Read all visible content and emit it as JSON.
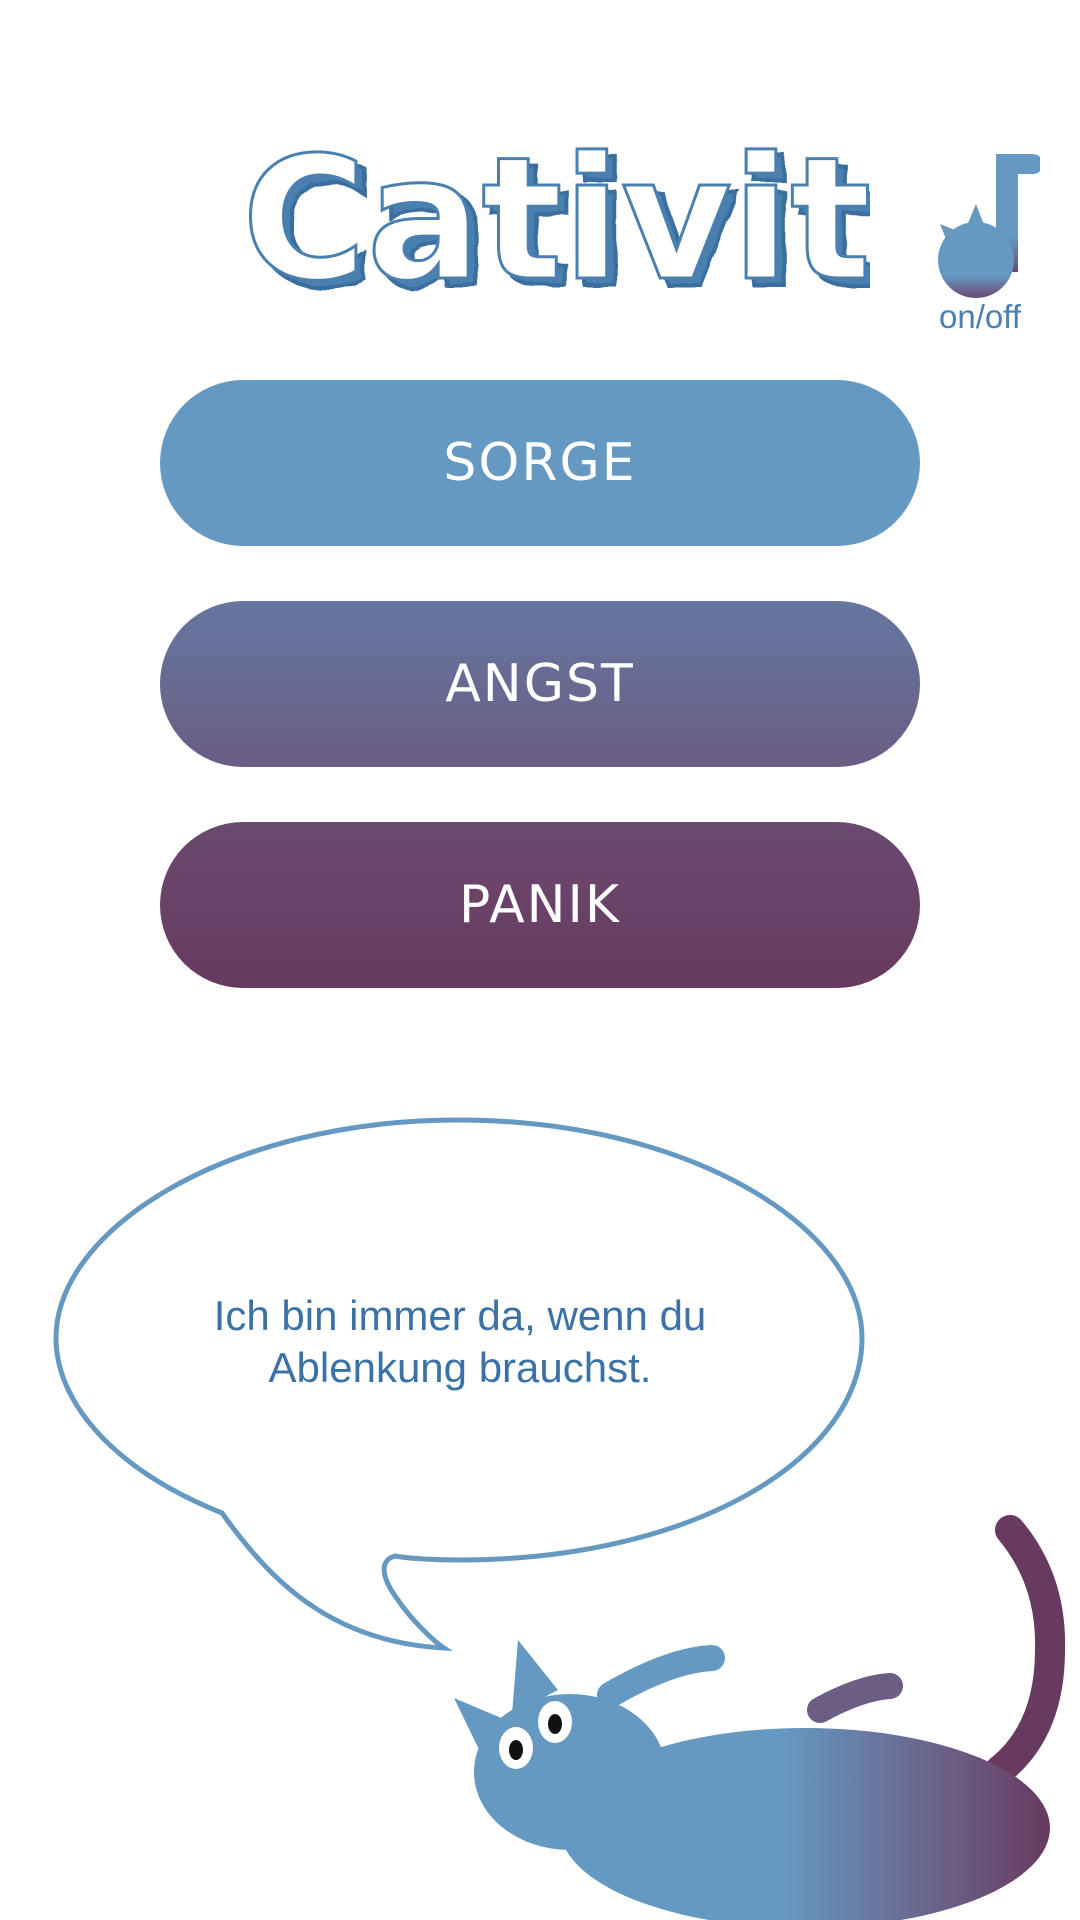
{
  "app": {
    "title": "Cativity"
  },
  "music": {
    "icon": "cat-music-note-icon",
    "label": "on/off"
  },
  "moods": [
    {
      "label": "SORGE",
      "color": "#6599c2"
    },
    {
      "label": "ANGST",
      "color": "#6a6a93"
    },
    {
      "label": "PANIK",
      "color": "#683d62"
    }
  ],
  "speech": {
    "line1": "Ich bin immer da, wenn du",
    "line2": "Ablenkung brauchst."
  },
  "colors": {
    "blue": "#6599c2",
    "purple": "#683a5f",
    "title_blue": "#4a80b0"
  }
}
